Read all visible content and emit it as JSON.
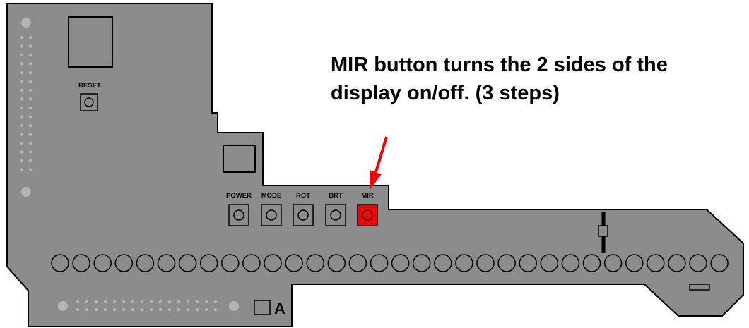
{
  "caption": {
    "line1": "MIR button turns the 2 sides of the",
    "line2": "display on/off.  (3 steps)"
  },
  "board": {
    "reset_label": "RESET",
    "corner_label": "A",
    "buttons": [
      {
        "label": "POWER",
        "highlighted": false
      },
      {
        "label": "MODE",
        "highlighted": false
      },
      {
        "label": "ROT",
        "highlighted": false
      },
      {
        "label": "BRT",
        "highlighted": false
      },
      {
        "label": "MIR",
        "highlighted": true
      }
    ],
    "led_count": 32
  },
  "colors": {
    "board": "#8c8c8c",
    "outline": "#000000",
    "dots": "#b4b4b4",
    "highlight": "#ff0000",
    "arrow": "#ff0000"
  }
}
